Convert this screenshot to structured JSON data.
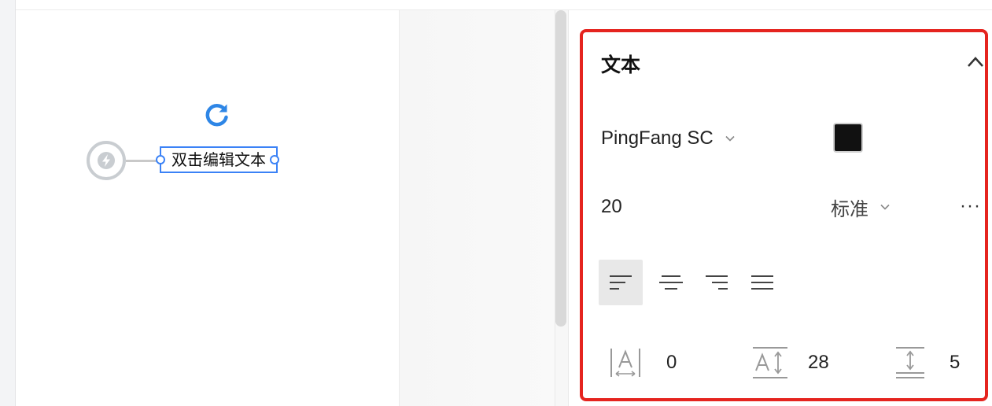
{
  "canvas": {
    "text_node": "双击编辑文本"
  },
  "panel": {
    "title": "文本",
    "font_family": "PingFang SC",
    "text_color": "#111111",
    "font_size": "20",
    "font_weight": "标准",
    "more": "···",
    "alignment": {
      "selected": "left",
      "options": [
        "left",
        "center",
        "right",
        "justify"
      ]
    },
    "letter_spacing": "0",
    "line_height": "28",
    "paragraph_spacing": "5"
  },
  "icons": {
    "refresh": "refresh-icon",
    "trigger": "lightning-icon",
    "collapse": "chevron-up-icon",
    "dropdown": "chevron-down-icon",
    "letter_spacing": "letter-spacing-icon",
    "line_height": "line-height-icon",
    "paragraph_spacing": "paragraph-spacing-icon"
  },
  "colors": {
    "highlight_border": "#e5241f",
    "selection": "#3b82f6",
    "accent": "#2e86e6"
  }
}
